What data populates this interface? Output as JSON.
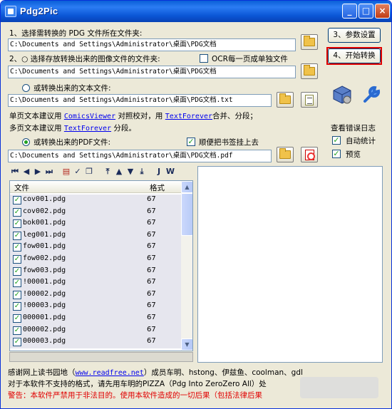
{
  "window": {
    "title": "Pdg2Pic",
    "min": "_",
    "max": "□",
    "close": "×"
  },
  "step1": {
    "label": "1、选择需转换的 PDG 文件所在文件夹:",
    "path": "C:\\Documents and Settings\\Administrator\\桌面\\PDG文档"
  },
  "step2": {
    "label": "2、○ 选择存放转换出来的图像文件的文件夹:",
    "ocr_label": "OCR每一页成单独文件",
    "path": "C:\\Documents and Settings\\Administrator\\桌面\\PDG文档"
  },
  "text_opt": {
    "label": "或转换出来的文本文件:",
    "path": "C:\\Documents and Settings\\Administrator\\桌面\\PDG文档.txt"
  },
  "hint": {
    "line1_a": "单页文本建议用",
    "link1": "ComicsViewer",
    "line1_b": "对照校对，用",
    "link2": "TextForever",
    "line1_c": "合并、分段；",
    "line2_a": "多页文本建议用",
    "link3": "TextForever",
    "line2_b": "分段。"
  },
  "pdf_opt": {
    "label": "或转换出来的PDF文件:",
    "bookmark_label": "顺便把书签挂上去",
    "path": "C:\\Documents and Settings\\Administrator\\桌面\\PDG文档.pdf"
  },
  "buttons": {
    "settings": "3、参数设置",
    "start": "4、开始转换"
  },
  "log": {
    "title": "查看错误日志",
    "auto_stat": "自动统计",
    "preview": "预览"
  },
  "toolbar": {
    "j": "J",
    "w": "W"
  },
  "list": {
    "col_file": "文件",
    "col_format": "格式",
    "rows": [
      {
        "name": "cov001.pdg",
        "fmt": "67"
      },
      {
        "name": "cov002.pdg",
        "fmt": "67"
      },
      {
        "name": "bok001.pdg",
        "fmt": "67"
      },
      {
        "name": "leg001.pdg",
        "fmt": "67"
      },
      {
        "name": "fow001.pdg",
        "fmt": "67"
      },
      {
        "name": "fow002.pdg",
        "fmt": "67"
      },
      {
        "name": "fow003.pdg",
        "fmt": "67"
      },
      {
        "name": "!00001.pdg",
        "fmt": "67"
      },
      {
        "name": "!00002.pdg",
        "fmt": "67"
      },
      {
        "name": "!00003.pdg",
        "fmt": "67"
      },
      {
        "name": "000001.pdg",
        "fmt": "67"
      },
      {
        "name": "000002.pdg",
        "fmt": "67"
      },
      {
        "name": "000003.pdg",
        "fmt": "67"
      }
    ]
  },
  "footer": {
    "line1_a": "感谢网上读书园地（",
    "line1_link": "www.readfree.net",
    "line1_b": "）成员车明、hstong、伊兹鱼、coolman、gdl",
    "line2": "对于本软件不支持的格式，请先用车明的PIZZA（Pdg Into ZeroZero All）处",
    "line3": "警告：本软件严禁用于非法目的。使用本软件造成的一切后果（包括法律后果"
  }
}
